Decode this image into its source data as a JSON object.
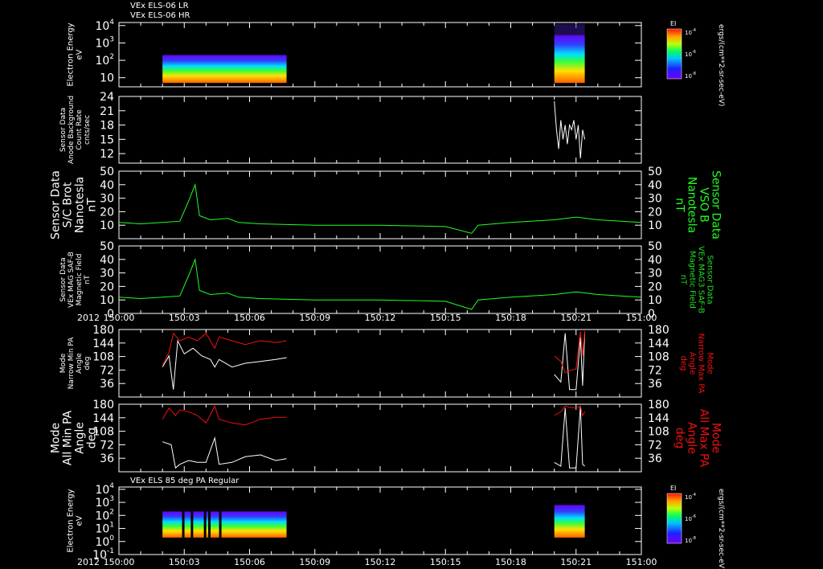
{
  "header": {
    "line1": "VEx ELS-06 LR",
    "line2": "VEx ELS-06 HR",
    "panel7_title": "VEx ELS 85 deg PA Regular"
  },
  "colors": {
    "background": "#000000",
    "axis": "#ffffff",
    "green": "#22ff22",
    "red": "#ee1111",
    "white": "#ffffff"
  },
  "chart_data": {
    "type": "line",
    "x_start": "150:00",
    "x_end": "151:00",
    "x_ticks": [
      "150:00",
      "150:03",
      "150:06",
      "150:09",
      "150:12",
      "150:15",
      "150:18",
      "150:21",
      "151:00"
    ],
    "year_label": "2012",
    "panels": [
      {
        "id": "p1",
        "type": "spectrogram",
        "ylabel_lines": [
          "Electron Energy",
          "eV"
        ],
        "ylim": [
          3,
          15000
        ],
        "log": true,
        "y_ticks": [
          {
            "label": "10",
            "exp": "4",
            "v": 10000
          },
          {
            "label": "10",
            "exp": "3",
            "v": 1000
          },
          {
            "label": "10",
            "exp": "2",
            "v": 100
          },
          {
            "label": "10",
            "exp": "",
            "v": 10
          }
        ],
        "colorbar": {
          "title": "EI",
          "ticks": [
            "10",
            "10",
            "10"
          ],
          "tick_exps": [
            "-4",
            "-6",
            "-8"
          ],
          "units": "ergs/(cm**2-sr-sec-eV)"
        }
      },
      {
        "id": "p2",
        "type": "line",
        "ylabel_lines": [
          "Sensor Data",
          "Anode Background",
          "Count Rate",
          "cnts/sec"
        ],
        "ylim": [
          10,
          24
        ],
        "y_ticks": [
          24,
          21,
          18,
          15,
          12
        ],
        "series": [
          {
            "color": "white",
            "points": [
              [
                20.0,
                23
              ],
              [
                20.1,
                17
              ],
              [
                20.2,
                13
              ],
              [
                20.3,
                19
              ],
              [
                20.4,
                15
              ],
              [
                20.5,
                18
              ],
              [
                20.6,
                14
              ],
              [
                20.7,
                18
              ],
              [
                20.8,
                17
              ],
              [
                20.9,
                19
              ],
              [
                21.0,
                15
              ],
              [
                21.1,
                18
              ],
              [
                21.2,
                11
              ],
              [
                21.3,
                17
              ],
              [
                21.4,
                15
              ]
            ]
          }
        ]
      },
      {
        "id": "p3",
        "type": "line",
        "ylabel_lines": [
          "Sensor Data",
          "S/C Brot",
          "Nanotesla",
          "nT"
        ],
        "ylabel_right_lines": [
          "Sensor Data",
          "VSO B",
          "Nanotesla",
          "nT"
        ],
        "ylim": [
          0,
          50
        ],
        "y_ticks": [
          50,
          40,
          30,
          20,
          10
        ],
        "y_ticks_right": [
          50,
          40,
          30,
          20,
          10
        ],
        "series": [
          {
            "color": "green",
            "points": [
              [
                0,
                12
              ],
              [
                1,
                11
              ],
              [
                2,
                12
              ],
              [
                2.8,
                13
              ],
              [
                3.2,
                28
              ],
              [
                3.5,
                40
              ],
              [
                3.7,
                17
              ],
              [
                4.2,
                14
              ],
              [
                5,
                15
              ],
              [
                5.5,
                12
              ],
              [
                6.5,
                11
              ],
              [
                9,
                10
              ],
              [
                12,
                10
              ],
              [
                15,
                9
              ],
              [
                16.2,
                4
              ],
              [
                16.5,
                10
              ],
              [
                18,
                12
              ],
              [
                20,
                14
              ],
              [
                21,
                16
              ],
              [
                22,
                14
              ],
              [
                24,
                12
              ]
            ]
          }
        ]
      },
      {
        "id": "p4",
        "type": "line",
        "ylabel_lines": [
          "Sensor Data",
          "VEx MAG SAF-B",
          "Magnetic Field",
          "nT"
        ],
        "ylabel_right_lines": [
          "Sensor Data",
          "VEx MAG3 SAF-B",
          "Magnetic Field",
          "nT"
        ],
        "ylim": [
          0,
          50
        ],
        "y_ticks": [
          50,
          40,
          30,
          20,
          10,
          0
        ],
        "y_ticks_right": [
          50,
          40,
          30,
          20,
          10,
          0
        ],
        "series": [
          {
            "color": "green",
            "points": [
              [
                0,
                12
              ],
              [
                1,
                11
              ],
              [
                2,
                12
              ],
              [
                2.8,
                13
              ],
              [
                3.2,
                28
              ],
              [
                3.5,
                40
              ],
              [
                3.7,
                17
              ],
              [
                4.2,
                14
              ],
              [
                5,
                15
              ],
              [
                5.5,
                12
              ],
              [
                6.5,
                11
              ],
              [
                9,
                10
              ],
              [
                12,
                10
              ],
              [
                15,
                9
              ],
              [
                16.2,
                3
              ],
              [
                16.5,
                10
              ],
              [
                18,
                12
              ],
              [
                20,
                14
              ],
              [
                21,
                16
              ],
              [
                22,
                14
              ],
              [
                24,
                12
              ]
            ]
          }
        ]
      },
      {
        "id": "p5",
        "type": "line",
        "ylabel_lines": [
          "Mode",
          "Narrow Min PA",
          "Angle",
          "deg"
        ],
        "ylabel_right_lines": [
          "Mode",
          "Narrow Max PA",
          "Angle",
          "deg"
        ],
        "ylim": [
          0,
          180
        ],
        "y_ticks": [
          180,
          144,
          108,
          72,
          36
        ],
        "y_ticks_right": [
          180,
          144,
          108,
          72,
          36
        ],
        "series": [
          {
            "color": "white",
            "points": [
              [
                2.0,
                80
              ],
              [
                2.3,
                110
              ],
              [
                2.5,
                20
              ],
              [
                2.7,
                150
              ],
              [
                3.0,
                115
              ],
              [
                3.4,
                130
              ],
              [
                3.8,
                110
              ],
              [
                4.2,
                100
              ],
              [
                4.4,
                80
              ],
              [
                4.6,
                100
              ],
              [
                5.2,
                80
              ],
              [
                5.8,
                90
              ],
              [
                6.5,
                95
              ],
              [
                7.2,
                100
              ],
              [
                7.7,
                105
              ]
            ]
          },
          {
            "color": "red",
            "points": [
              [
                2.0,
                85
              ],
              [
                2.3,
                120
              ],
              [
                2.5,
                170
              ],
              [
                2.8,
                150
              ],
              [
                3.2,
                160
              ],
              [
                3.6,
                150
              ],
              [
                4.0,
                170
              ],
              [
                4.4,
                130
              ],
              [
                4.6,
                160
              ],
              [
                5.2,
                150
              ],
              [
                5.8,
                140
              ],
              [
                6.5,
                150
              ],
              [
                7.2,
                145
              ],
              [
                7.7,
                150
              ]
            ]
          },
          {
            "color": "white",
            "points": [
              [
                20.0,
                60
              ],
              [
                20.3,
                40
              ],
              [
                20.5,
                170
              ],
              [
                20.7,
                20
              ],
              [
                21.0,
                20
              ],
              [
                21.2,
                160
              ],
              [
                21.3,
                30
              ],
              [
                21.4,
                175
              ]
            ]
          },
          {
            "color": "red",
            "points": [
              [
                20.0,
                110
              ],
              [
                20.3,
                95
              ],
              [
                20.5,
                65
              ],
              [
                20.7,
                70
              ],
              [
                21.0,
                75
              ],
              [
                21.2,
                175
              ],
              [
                21.3,
                110
              ],
              [
                21.4,
                175
              ]
            ]
          }
        ]
      },
      {
        "id": "p6",
        "type": "line",
        "ylabel_lines": [
          "Mode",
          "All Min PA",
          "Angle",
          "deg"
        ],
        "ylabel_right_lines": [
          "Mode",
          "All Max PA",
          "Angle",
          "deg"
        ],
        "ylim": [
          0,
          180
        ],
        "y_ticks": [
          180,
          144,
          108,
          72,
          36
        ],
        "y_ticks_right": [
          180,
          144,
          108,
          72,
          36
        ],
        "series": [
          {
            "color": "white",
            "points": [
              [
                2.0,
                80
              ],
              [
                2.4,
                72
              ],
              [
                2.6,
                10
              ],
              [
                2.8,
                20
              ],
              [
                3.2,
                30
              ],
              [
                3.6,
                25
              ],
              [
                4.0,
                25
              ],
              [
                4.4,
                90
              ],
              [
                4.6,
                20
              ],
              [
                5.2,
                25
              ],
              [
                5.8,
                40
              ],
              [
                6.5,
                45
              ],
              [
                7.2,
                30
              ],
              [
                7.7,
                35
              ]
            ]
          },
          {
            "color": "red",
            "points": [
              [
                2.0,
                140
              ],
              [
                2.3,
                170
              ],
              [
                2.6,
                150
              ],
              [
                2.8,
                165
              ],
              [
                3.2,
                160
              ],
              [
                3.6,
                150
              ],
              [
                4.0,
                130
              ],
              [
                4.4,
                175
              ],
              [
                4.6,
                140
              ],
              [
                5.2,
                130
              ],
              [
                5.8,
                125
              ],
              [
                6.5,
                140
              ],
              [
                7.2,
                145
              ],
              [
                7.7,
                145
              ]
            ]
          },
          {
            "color": "white",
            "points": [
              [
                20.0,
                25
              ],
              [
                20.3,
                15
              ],
              [
                20.5,
                170
              ],
              [
                20.7,
                10
              ],
              [
                21.0,
                10
              ],
              [
                21.2,
                175
              ],
              [
                21.3,
                20
              ],
              [
                21.4,
                15
              ]
            ]
          },
          {
            "color": "red",
            "points": [
              [
                20.0,
                150
              ],
              [
                20.3,
                160
              ],
              [
                20.5,
                175
              ],
              [
                20.7,
                172
              ],
              [
                21.0,
                170
              ],
              [
                21.2,
                175
              ],
              [
                21.3,
                150
              ],
              [
                21.4,
                160
              ]
            ]
          }
        ]
      },
      {
        "id": "p7",
        "type": "spectrogram",
        "ylabel_lines": [
          "Electron Energy",
          "eV"
        ],
        "ylim": [
          0.1,
          15000
        ],
        "log": true,
        "y_ticks": [
          {
            "label": "10",
            "exp": "4",
            "v": 10000
          },
          {
            "label": "10",
            "exp": "3",
            "v": 1000
          },
          {
            "label": "10",
            "exp": "2",
            "v": 100
          },
          {
            "label": "10",
            "exp": "1",
            "v": 10
          },
          {
            "label": "10",
            "exp": "0",
            "v": 1
          },
          {
            "label": "10",
            "exp": "-1",
            "v": 0.1
          }
        ],
        "colorbar": {
          "title": "EI",
          "ticks": [
            "10",
            "10",
            "10"
          ],
          "tick_exps": [
            "-4",
            "-6",
            "-8"
          ],
          "units": "ergs/(cm**2-sr-sec-eV)"
        }
      }
    ]
  }
}
